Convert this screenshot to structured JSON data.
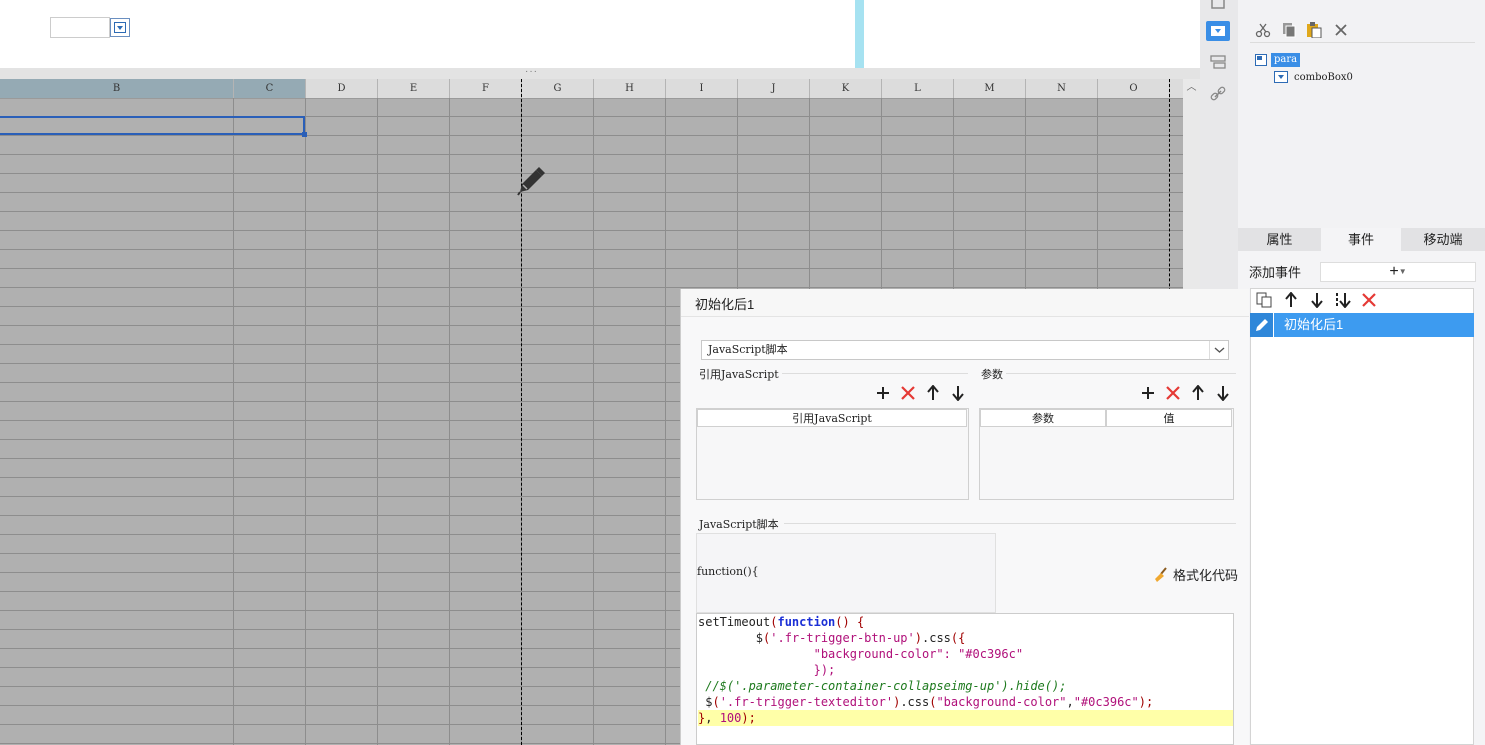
{
  "colors": {
    "accent": "#3d9bf0",
    "selection_border": "#2a5fb8",
    "param_strip": "#a6e2f1",
    "delete_red": "#e53935"
  },
  "grid": {
    "columns": [
      "B",
      "C",
      "D",
      "E",
      "F",
      "G",
      "H",
      "I",
      "J",
      "K",
      "L",
      "M",
      "N",
      "O"
    ],
    "selected_columns": [
      "B",
      "C"
    ]
  },
  "widget_tree": {
    "root": "para",
    "child": "comboBox0"
  },
  "tabs": [
    "属性",
    "事件",
    "移动端"
  ],
  "active_tab": "事件",
  "events": {
    "add_label": "添加事件",
    "add_button": "+",
    "items": [
      "初始化后1"
    ]
  },
  "dialog": {
    "title": "初始化后1",
    "script_type": "JavaScript脚本",
    "ref_section": "引用JavaScript",
    "params_section": "参数",
    "ref_column": "引用JavaScript",
    "param_column": "参数",
    "value_column": "值",
    "script_section": "JavaScript脚本",
    "function_header": "function(){",
    "format_button": "格式化代码",
    "code_lines": [
      "setTimeout(function() {",
      "        $('.fr-trigger-btn-up').css({",
      "                \"background-color\": \"#0c396c\"",
      "                });",
      " //$('.parameter-container-collapseimg-up').hide();",
      " $('.fr-trigger-texteditor').css(\"background-color\",\"#0c396c\");",
      "}, 100);"
    ]
  }
}
